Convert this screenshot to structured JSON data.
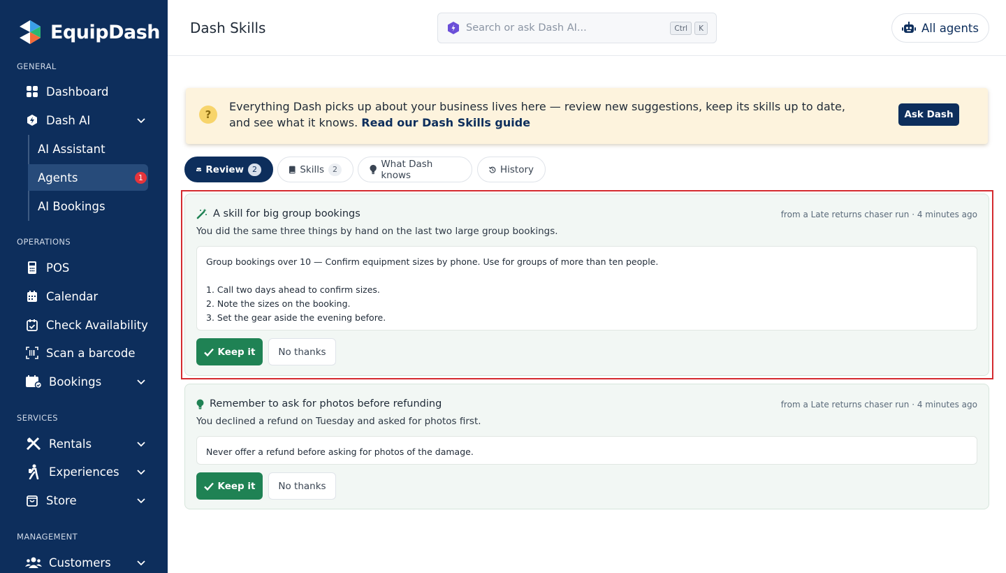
{
  "app": {
    "name": "EquipDash"
  },
  "sidebar": {
    "sections": {
      "general": "GENERAL",
      "operations": "OPERATIONS",
      "services": "SERVICES",
      "management": "MANAGEMENT"
    },
    "items": {
      "dashboard": "Dashboard",
      "dash_ai": "Dash AI",
      "ai_assistant": "AI Assistant",
      "agents": "Agents",
      "agents_badge": "1",
      "ai_bookings": "AI Bookings",
      "pos": "POS",
      "calendar": "Calendar",
      "check_availability": "Check Availability",
      "scan_barcode": "Scan a barcode",
      "bookings": "Bookings",
      "rentals": "Rentals",
      "experiences": "Experiences",
      "store": "Store",
      "customers": "Customers"
    }
  },
  "header": {
    "title": "Dash Skills",
    "search_placeholder": "Search or ask Dash AI...",
    "kbd_ctrl": "Ctrl",
    "kbd_k": "K",
    "agents_button": "All agents"
  },
  "banner": {
    "icon_glyph": "?",
    "text": "Everything Dash picks up about your business lives here — review new suggestions, keep its skills up to date, and see what it knows.",
    "link": "Read our Dash Skills guide",
    "button": "Ask Dash"
  },
  "tabs": [
    {
      "label": "Review",
      "count": "2"
    },
    {
      "label": "Skills",
      "count": "2"
    },
    {
      "label": "What Dash knows"
    },
    {
      "label": "History"
    }
  ],
  "suggestions": [
    {
      "title": "A skill for big group bookings",
      "meta": "from a Late returns chaser run · 4 minutes ago",
      "description": "You did the same three things by hand on the last two large group bookings.",
      "body_lines": [
        "Group bookings over 10 — Confirm equipment sizes by phone. Use for groups of more than ten people.",
        "1. Call two days ahead to confirm sizes.",
        "2. Note the sizes on the booking.",
        "3. Set the gear aside the evening before."
      ],
      "keep_label": "Keep it",
      "dismiss_label": "No thanks"
    },
    {
      "title": "Remember to ask for photos before refunding",
      "meta": "from a Late returns chaser run · 4 minutes ago",
      "description": "You declined a refund on Tuesday and asked for photos first.",
      "body_lines": [
        "Never offer a refund before asking for photos of the damage."
      ],
      "keep_label": "Keep it",
      "dismiss_label": "No thanks"
    }
  ],
  "colors": {
    "sidebar_bg": "#0d2e5c",
    "accent_green": "#1f8254",
    "highlight_red": "#d42a2f",
    "banner_bg": "#fdf3dd"
  }
}
